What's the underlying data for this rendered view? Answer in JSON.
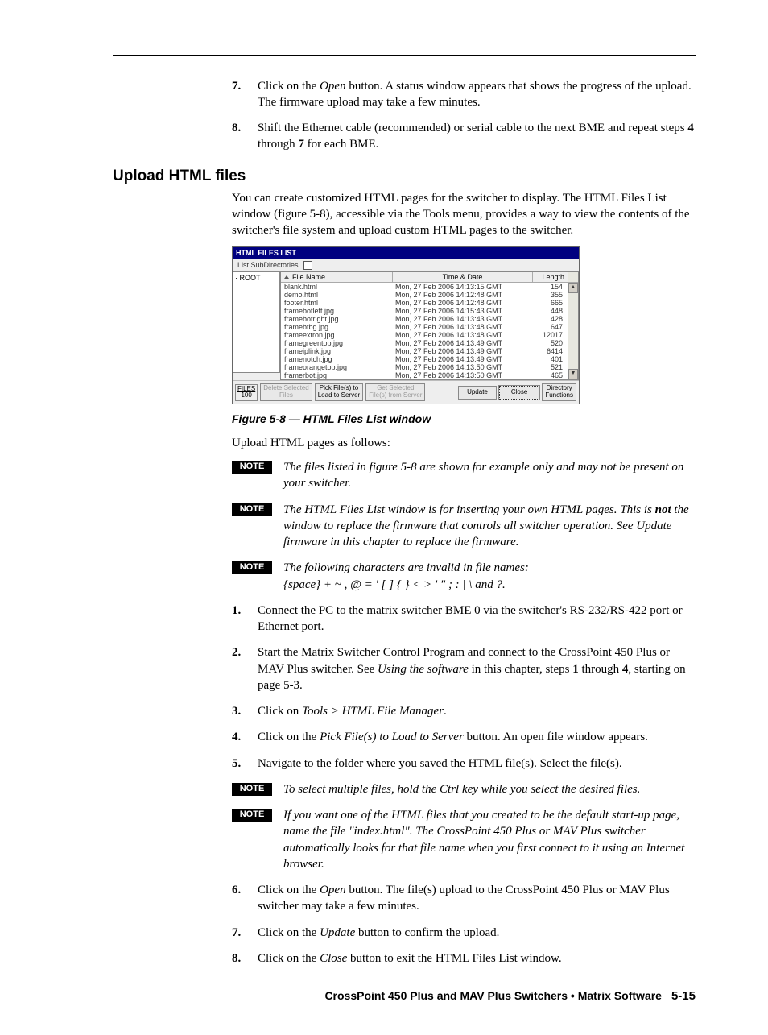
{
  "intro_steps": [
    {
      "n": "7.",
      "body_before": "Click on the ",
      "body_i": "Open",
      "body_after": " button.  A status window appears that shows the progress of the upload.  The firmware upload may take a few minutes."
    },
    {
      "n": "8.",
      "body": "Shift the Ethernet cable (recommended) or serial cable to the next BME and repeat steps 4 through 7 for each BME.",
      "bold_runs": [
        "4",
        "7"
      ]
    }
  ],
  "h2": "Upload HTML files",
  "intro_para": "You can create customized HTML pages for the switcher to display.  The HTML Files List window (figure 5-8), accessible via the Tools menu, provides a way to view the contents of the switcher's file system and upload custom HTML pages to the switcher.",
  "shot": {
    "title": "HTML FILES LIST",
    "subdir_label": "List SubDirectories",
    "tree_root": "ROOT",
    "cols": {
      "name": "File Name",
      "date": "Time & Date",
      "len": "Length"
    },
    "rows": [
      {
        "name": "blank.html",
        "date": "Mon, 27 Feb 2006 14:13:15 GMT",
        "len": "154"
      },
      {
        "name": "demo.html",
        "date": "Mon, 27 Feb 2006 14:12:48 GMT",
        "len": "355"
      },
      {
        "name": "footer.html",
        "date": "Mon, 27 Feb 2006 14:12:48 GMT",
        "len": "665"
      },
      {
        "name": "framebotleft.jpg",
        "date": "Mon, 27 Feb 2006 14:15:43 GMT",
        "len": "448"
      },
      {
        "name": "framebotright.jpg",
        "date": "Mon, 27 Feb 2006 14:13:43 GMT",
        "len": "428"
      },
      {
        "name": "framebtbg.jpg",
        "date": "Mon, 27 Feb 2006 14:13:48 GMT",
        "len": "647"
      },
      {
        "name": "frameextron.jpg",
        "date": "Mon, 27 Feb 2006 14:13:48 GMT",
        "len": "12017"
      },
      {
        "name": "framegreentop.jpg",
        "date": "Mon, 27 Feb 2006 14:13:49 GMT",
        "len": "520"
      },
      {
        "name": "frameiplink.jpg",
        "date": "Mon, 27 Feb 2006 14:13:49 GMT",
        "len": "6414"
      },
      {
        "name": "framenotch.jpg",
        "date": "Mon, 27 Feb 2006 14:13:49 GMT",
        "len": "401"
      },
      {
        "name": "frameorangetop.jpg",
        "date": "Mon, 27 Feb 2006 14:13:50 GMT",
        "len": "521"
      },
      {
        "name": "framerbot.jpg",
        "date": "Mon, 27 Feb 2006 14:13:50 GMT",
        "len": "465"
      }
    ],
    "files_label_top": "FILES",
    "files_label_bot": "100",
    "btn_delete": "Delete Selected\nFiles",
    "btn_pick": "Pick File(s) to\nLoad to Server",
    "btn_get": "Get Selected\nFile(s) from Server",
    "btn_update": "Update",
    "btn_close": "Close",
    "btn_dir": "Directory\nFunctions"
  },
  "figcap": "Figure 5-8 — HTML Files List window",
  "upload_intro": "Upload HTML pages as follows:",
  "notes_a": [
    "The files listed in figure 5-8 are shown for example only and may not be present on your switcher.",
    "The HTML Files List window is for inserting your own HTML pages.  This is ",
    "The following characters are invalid in file names:"
  ],
  "note2_rest": " the window to replace the firmware that controls all switcher operation.  See Update firmware in this chapter to replace the firmware.",
  "note2_not": "not",
  "note3_line2": "{space}  +  ~  ,  @  =  '  [  ]  {  }  <  >  '  \"  ;  :  |  \\  and ?.",
  "note_label": "NOTE",
  "steps": [
    {
      "n": "1.",
      "body": "Connect the PC to the matrix switcher BME 0 via the switcher's RS-232/RS-422 port or Ethernet port."
    },
    {
      "n": "2.",
      "body_before": "Start the Matrix Switcher Control Program and connect to the CrossPoint 450 Plus or MAV Plus switcher.  See ",
      "body_i": "Using the software",
      "body_after": " in this chapter, steps 1 through 4, starting on page 5-3.",
      "bold_runs": [
        "1",
        "4"
      ]
    },
    {
      "n": "3.",
      "body_before": "Click on ",
      "body_i": "Tools > HTML File Manager",
      "body_after": "."
    },
    {
      "n": "4.",
      "body_before": "Click on the ",
      "body_i": "Pick File(s) to Load to Server",
      "body_after": " button.  An open file window appears."
    },
    {
      "n": "5.",
      "body": "Navigate to the folder where you saved the HTML file(s).  Select the file(s)."
    }
  ],
  "notes_b": [
    "To select multiple files, hold the Ctrl key while you select the desired files.",
    "If you want one of the HTML files that you created to be the default start-up page, name the file \"index.html\".  The CrossPoint 450 Plus or MAV Plus switcher automatically looks for that file name when you first connect to it using an Internet browser."
  ],
  "steps2": [
    {
      "n": "6.",
      "body_before": "Click on the ",
      "body_i": "Open",
      "body_after": " button.  The file(s) upload to the CrossPoint 450 Plus or MAV Plus switcher may take a few minutes."
    },
    {
      "n": "7.",
      "body_before": "Click on the ",
      "body_i": "Update",
      "body_after": " button to confirm the upload."
    },
    {
      "n": "8.",
      "body_before": "Click on the ",
      "body_i": "Close",
      "body_after": " button to exit the HTML Files List window."
    }
  ],
  "footer_text": "CrossPoint 450 Plus and MAV Plus Switchers • Matrix Software",
  "footer_page": "5-15"
}
